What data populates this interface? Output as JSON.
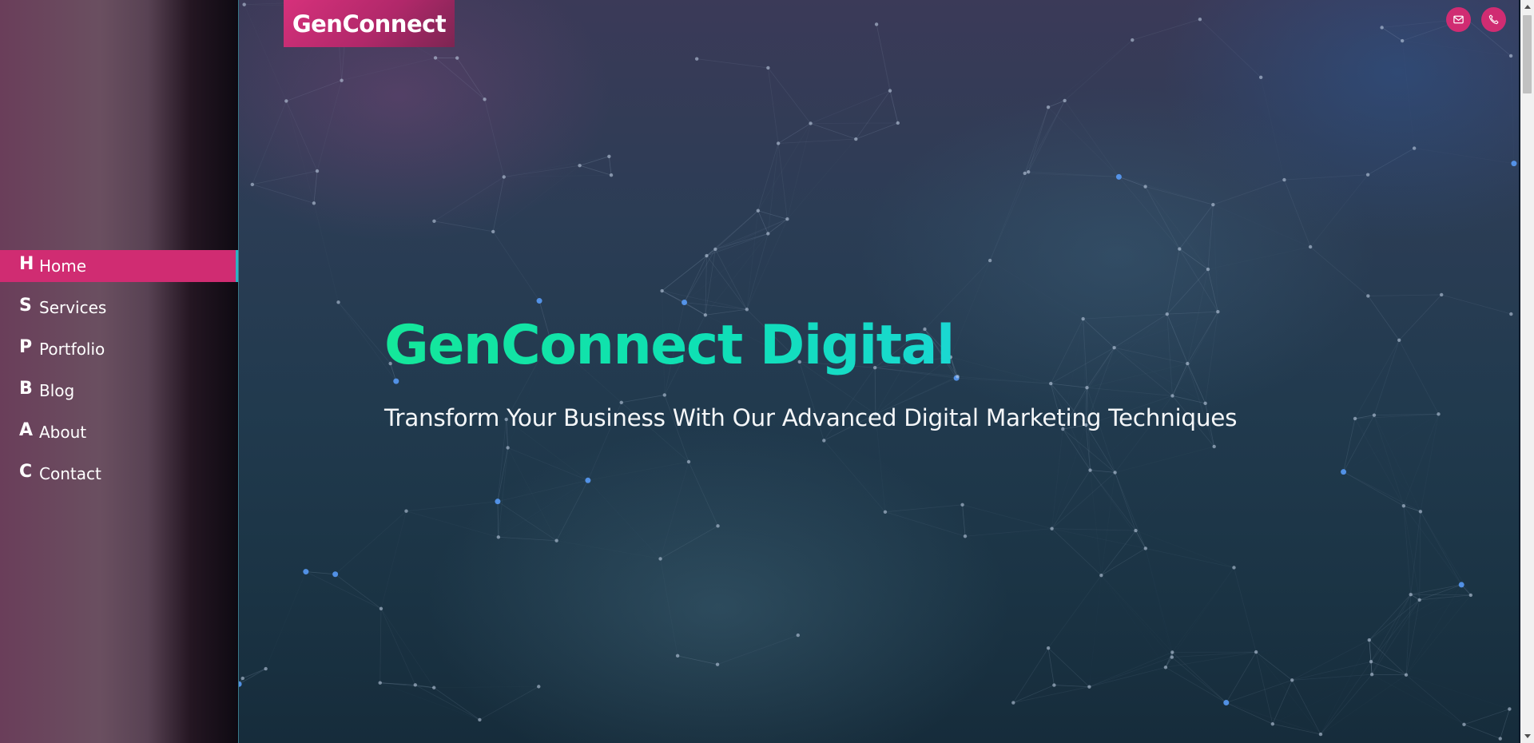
{
  "sidebar": {
    "items": [
      {
        "letter": "H",
        "label": "Home",
        "active": true
      },
      {
        "letter": "S",
        "label": "Services",
        "active": false
      },
      {
        "letter": "P",
        "label": "Portfolio",
        "active": false
      },
      {
        "letter": "B",
        "label": "Blog",
        "active": false
      },
      {
        "letter": "A",
        "label": "About",
        "active": false
      },
      {
        "letter": "C",
        "label": "Contact",
        "active": false
      }
    ]
  },
  "header": {
    "logo": "GenConnect",
    "icons": [
      "mail-icon",
      "phone-icon"
    ]
  },
  "hero": {
    "title": "GenConnect Digital",
    "subtitle": "Transform Your Business With Our Advanced Digital Marketing Techniques"
  },
  "colors": {
    "accent": "#d02c72",
    "title_gradient_start": "#14e79a",
    "title_gradient_end": "#1ad8d2"
  }
}
